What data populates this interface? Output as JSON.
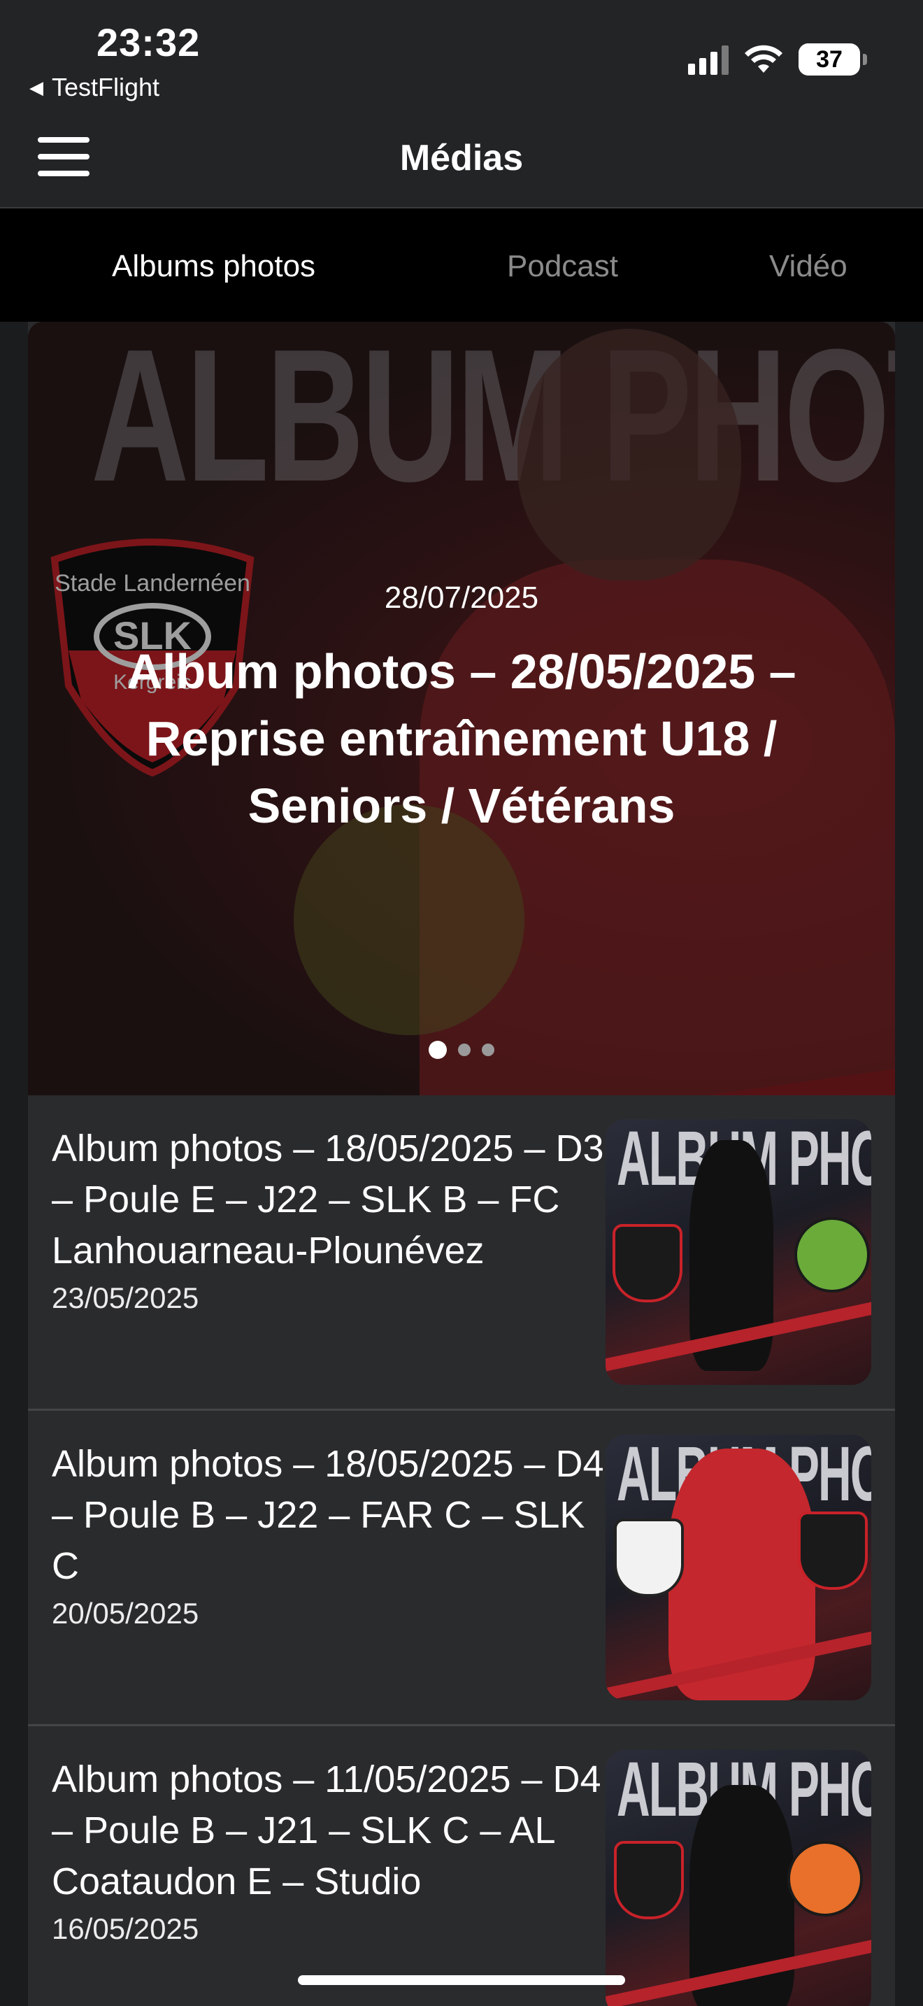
{
  "status_bar": {
    "time": "23:32",
    "back_app": "TestFlight",
    "battery": "37",
    "icons": [
      "signal-icon",
      "wifi-icon",
      "battery-icon"
    ]
  },
  "header": {
    "title": "Médias",
    "menu_icon": "hamburger-menu-icon"
  },
  "tabs": [
    {
      "label": "Albums photos",
      "active": true
    },
    {
      "label": "Podcast",
      "active": false
    },
    {
      "label": "Vidéo",
      "active": false
    }
  ],
  "hero": {
    "background_text": "ALBUM PHOTOS",
    "date": "28/07/2025",
    "title": "Album photos – 28/05/2025 – Reprise entraînement U18 / Seniors / Vétérans",
    "crest_text": "Stade Landernéen",
    "crest_abbr": "SLK",
    "crest_sub": "Kergreis",
    "slides": 3,
    "active_slide": 1
  },
  "albums": [
    {
      "title": "Album photos – 18/05/2025 – D3 – Poule E – J22 – SLK B – FC Lanhouarneau-Plounévez",
      "date": "23/05/2025",
      "thumb_text": "ALBUM PHOTOS"
    },
    {
      "title": "Album photos – 18/05/2025 – D4 – Poule B – J22 – FAR C – SLK C",
      "date": "20/05/2025",
      "thumb_text": "ALBUM PHOTOS"
    },
    {
      "title": "Album photos – 11/05/2025 – D4 – Poule B – J21 – SLK C – AL Coataudon E – Studio",
      "date": "16/05/2025",
      "thumb_text": "ALBUM PHOTOS"
    }
  ],
  "colors": {
    "accent_red": "#c82229",
    "background": "#1b1c1e",
    "card": "#2a2b2d",
    "tab_bar": "#000000"
  }
}
